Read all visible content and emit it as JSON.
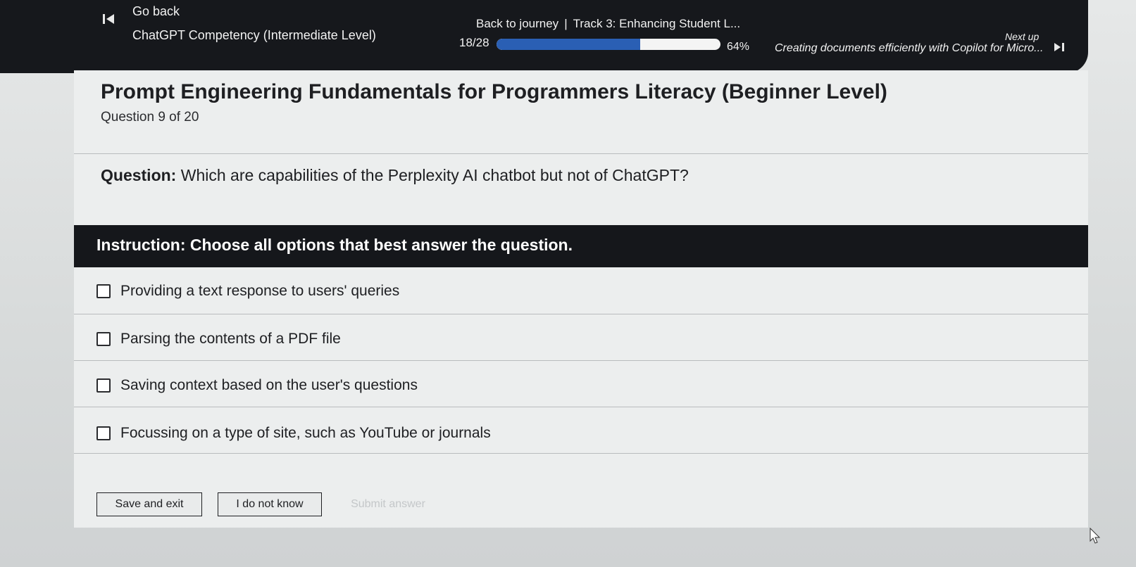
{
  "topbar": {
    "go_back_label": "Go back",
    "course_title": "ChatGPT Competency (Intermediate Level)",
    "journey_link": "Back to journey",
    "journey_separator": "|",
    "track_title": "Track 3: Enhancing Student L...",
    "progress_count": "18/28",
    "progress_percent_label": "64%",
    "progress_fraction": 0.64,
    "next_up_label": "Next up",
    "next_up_title": "Creating documents efficiently with Copilot for Micro..."
  },
  "quiz": {
    "title": "Prompt Engineering Fundamentals for Programmers Literacy (Beginner Level)",
    "question_count": "Question 9 of 20",
    "question_prefix": "Question:",
    "question_text": "Which are capabilities of the Perplexity AI chatbot but not of ChatGPT?",
    "instruction": "Instruction: Choose all options that best answer the question.",
    "options": [
      {
        "label": "Providing a text response to users' queries"
      },
      {
        "label": "Parsing the contents of a PDF file"
      },
      {
        "label": "Saving context based on the user's questions"
      },
      {
        "label": "Focussing on a type of site, such as YouTube or journals"
      }
    ]
  },
  "actions": {
    "save_label": "Save and exit",
    "dont_know_label": "I do not know",
    "submit_label": "Submit answer"
  },
  "colors": {
    "topbar_bg": "#16181c",
    "progress_fill": "#2a5fb4",
    "instruction_bg": "#15171b"
  }
}
